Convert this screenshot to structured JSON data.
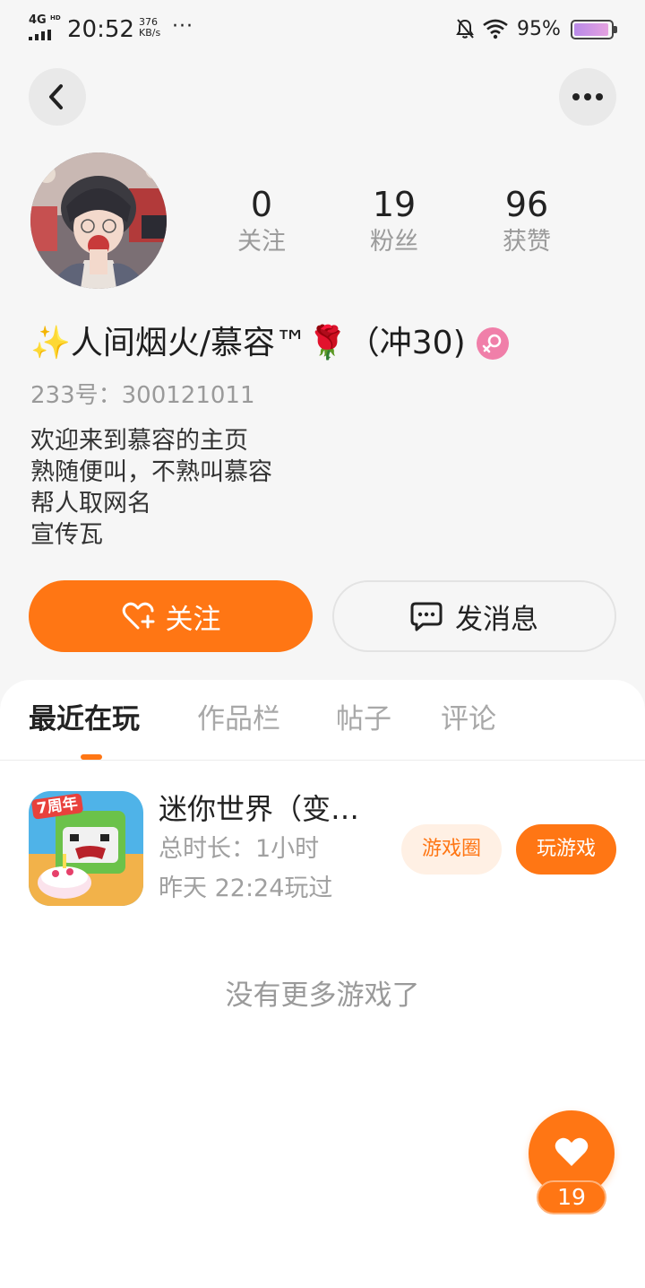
{
  "status_bar": {
    "network": "4G",
    "network_sup": "HD",
    "time": "20:52",
    "speed_value": "376",
    "speed_unit": "KB/s",
    "more": "···",
    "battery": "95%",
    "icons": [
      "signal-icon",
      "bell-off-icon",
      "wifi-icon",
      "battery-icon"
    ]
  },
  "header": {
    "back_icon": "chevron-left-icon",
    "more_icon": "more-dots-icon"
  },
  "profile": {
    "stats": [
      {
        "value": "0",
        "label": "关注"
      },
      {
        "value": "19",
        "label": "粉丝"
      },
      {
        "value": "96",
        "label": "获赞"
      }
    ],
    "nickname": "✨人间烟火/慕容™🌹（冲30)",
    "gender_icon": "female-icon",
    "uid": "233号：300121011",
    "bio": [
      "欢迎来到慕容的主页",
      "熟随便叫，不熟叫慕容",
      "帮人取网名",
      "宣传瓦"
    ]
  },
  "actions": {
    "follow_label": "关注",
    "message_label": "发消息"
  },
  "tabs": [
    "最近在玩",
    "作品栏",
    "帖子",
    "评论"
  ],
  "game": {
    "title": "迷你世界（变…",
    "duration": "总时长：1小时",
    "last_played": "昨天 22:24玩过",
    "icon_badge": "7周年",
    "circle_label": "游戏圈",
    "play_label": "玩游戏"
  },
  "empty_text": "没有更多游戏了",
  "likes": {
    "count": "19"
  },
  "colors": {
    "accent": "#ff7614",
    "accent_light": "#fff0e4",
    "gender_badge": "#f07fa9",
    "muted_text": "#9a9a9a"
  }
}
